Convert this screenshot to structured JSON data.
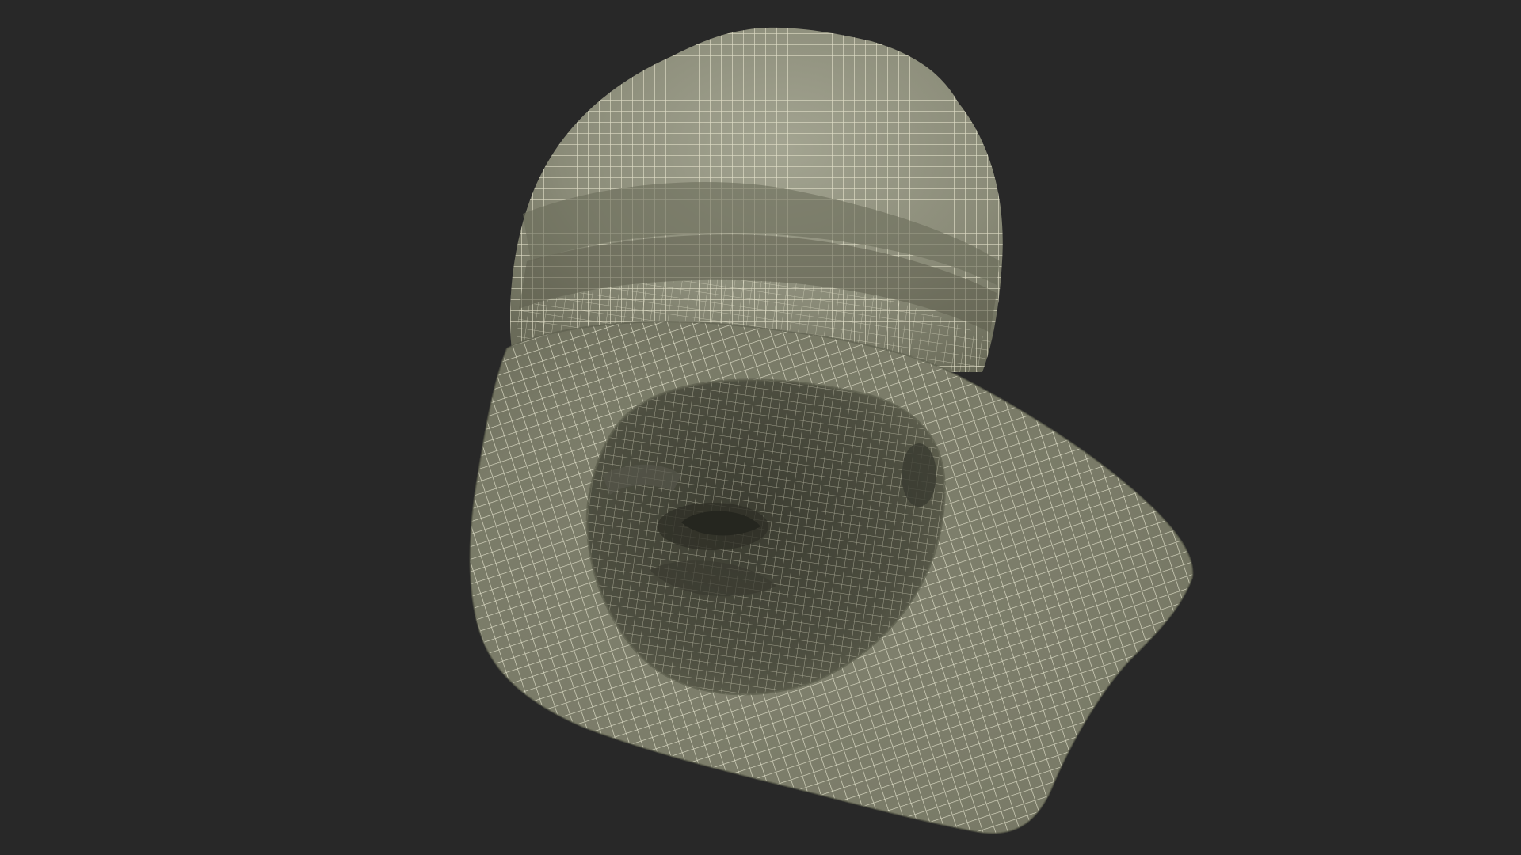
{
  "scene": {
    "subject_icon": "hooded-balaclava-wireframe-icon",
    "colors": {
      "background": "#282828",
      "surface_light": "#8e8f7d",
      "surface_mid": "#787966",
      "surface_dark": "#4a4b3d",
      "interior_deep": "#2e2f26",
      "wire": "#e8e6cf"
    }
  }
}
